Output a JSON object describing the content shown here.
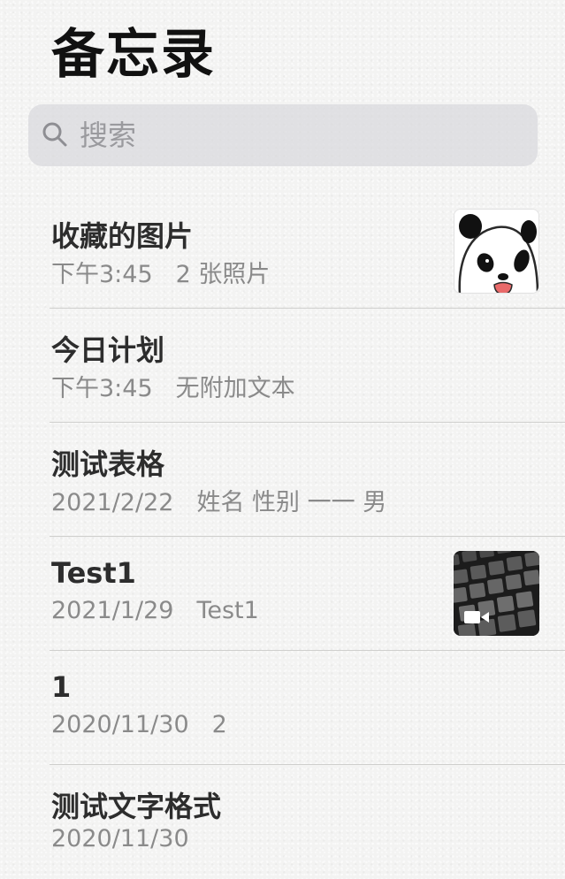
{
  "header": {
    "title": "备忘录"
  },
  "search": {
    "placeholder": "搜索",
    "icon": "search-icon"
  },
  "notes": [
    {
      "title": "收藏的图片",
      "date": "下午3:45",
      "preview": "2 张照片",
      "thumbnail": "panda-image"
    },
    {
      "title": "今日计划",
      "date": "下午3:45",
      "preview": "无附加文本"
    },
    {
      "title": "测试表格",
      "date": "2021/2/22",
      "preview": "姓名 性别 一一 男"
    },
    {
      "title": "Test1",
      "date": "2021/1/29",
      "preview": "Test1",
      "thumbnail": "keyboard-video"
    },
    {
      "title": "1",
      "date": "2020/11/30",
      "preview": "2"
    },
    {
      "title": "测试文字格式",
      "date": "2020/11/30",
      "preview": ""
    }
  ],
  "colors": {
    "background": "#f3f3f2",
    "search_bg": "#d8d8dc",
    "title_text": "#111111",
    "secondary_text": "#8a8a8a",
    "divider": "#cfcfcd"
  }
}
